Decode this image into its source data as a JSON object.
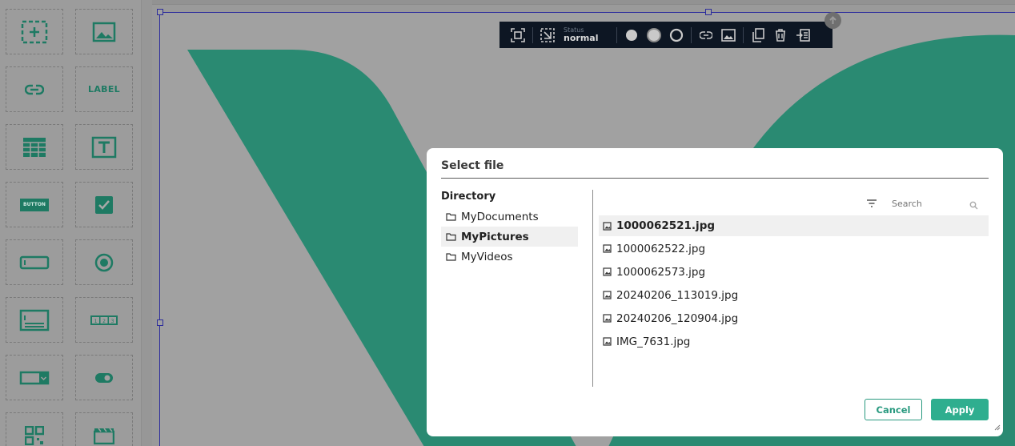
{
  "palette": {
    "items": [
      {
        "name": "add-container",
        "icon": "dashed-plus-icon"
      },
      {
        "name": "image",
        "icon": "image-icon"
      },
      {
        "name": "link",
        "icon": "link-icon"
      },
      {
        "name": "label",
        "text": "LABEL"
      },
      {
        "name": "table",
        "icon": "table-icon"
      },
      {
        "name": "text",
        "icon": "text-T-icon"
      },
      {
        "name": "button",
        "text": "BUTTON"
      },
      {
        "name": "checkbox",
        "icon": "checkbox-icon"
      },
      {
        "name": "input",
        "icon": "input-field-icon"
      },
      {
        "name": "radio",
        "icon": "radio-icon"
      },
      {
        "name": "textarea",
        "icon": "textarea-icon"
      },
      {
        "name": "pagination",
        "text": "123"
      },
      {
        "name": "dropdown",
        "icon": "dropdown-icon"
      },
      {
        "name": "toggle",
        "icon": "toggle-icon"
      },
      {
        "name": "qrcode",
        "icon": "qr-code-icon"
      },
      {
        "name": "video",
        "icon": "video-icon"
      }
    ]
  },
  "toolbar": {
    "status_label": "Status",
    "status_value": "normal"
  },
  "dialog": {
    "title": "Select file",
    "directory_heading": "Directory",
    "directories": [
      {
        "label": "MyDocuments",
        "selected": false
      },
      {
        "label": "MyPictures",
        "selected": true
      },
      {
        "label": "MyVideos",
        "selected": false
      }
    ],
    "search_placeholder": "Search",
    "files": [
      {
        "label": "1000062521.jpg",
        "selected": true
      },
      {
        "label": "1000062522.jpg",
        "selected": false
      },
      {
        "label": "1000062573.jpg",
        "selected": false
      },
      {
        "label": "20240206_113019.jpg",
        "selected": false
      },
      {
        "label": "20240206_120904.jpg",
        "selected": false
      },
      {
        "label": "IMG_7631.jpg",
        "selected": false
      }
    ],
    "cancel_label": "Cancel",
    "apply_label": "Apply"
  },
  "colors": {
    "brand_green": "#2fae8f",
    "canvas_shape": "#2a8a72",
    "toolbar_bg": "#0d1623"
  }
}
